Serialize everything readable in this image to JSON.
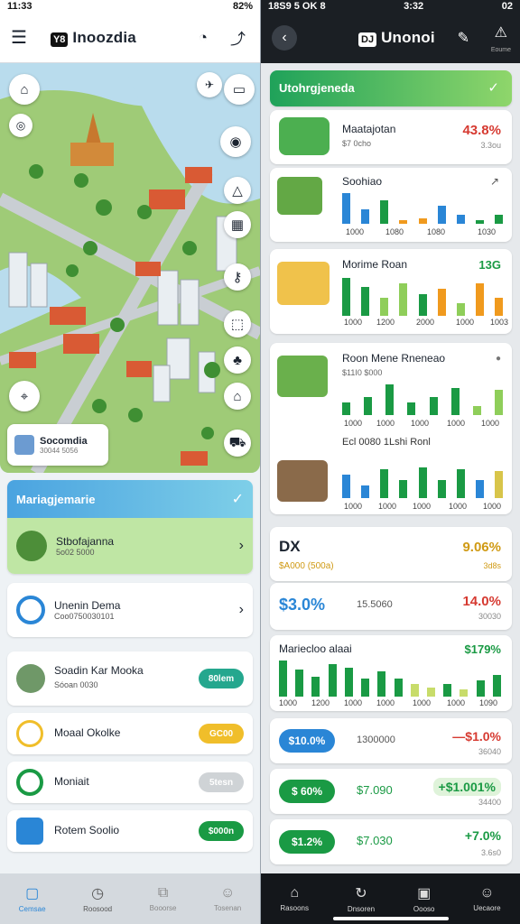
{
  "left": {
    "status": {
      "time": "11:33",
      "battery": "82%"
    },
    "title": "Inoozdia",
    "logo": "Y8",
    "map_label": {
      "title": "Socomdia",
      "sub": "30044 5056"
    },
    "section": {
      "title": "Mariagjemarie"
    },
    "rows": [
      {
        "title": "Stbofajanna",
        "sub": "5o02 5000",
        "action": "›"
      },
      {
        "title": "Unenin Dema",
        "sub": "Coo0750030101",
        "action": "›"
      },
      {
        "title": "Soadin Kar Mooka",
        "sub": "Sóoan 0030",
        "pill": "80lem",
        "color": "#25a78e"
      },
      {
        "title": "Moaal Okolke",
        "sub": "",
        "pill": "GC00",
        "color": "#f0be2a"
      },
      {
        "title": "Moniait",
        "sub": "",
        "pill": "5tesn",
        "color": "#cfd3d6"
      },
      {
        "title": "Rotem Soolio",
        "sub": "",
        "pill": "$000n",
        "color": "#1a9a44"
      }
    ],
    "tabs": [
      "Cemsae",
      "Roosood",
      "Booorse",
      "Tosenan"
    ]
  },
  "right": {
    "status": {
      "time": "3:32",
      "carrier": "18S9 5 OK 8",
      "battery": "02"
    },
    "title": "Unonoi",
    "logo": "DJ",
    "header_note": "Eoume",
    "section": {
      "title": "Utohrgjeneda"
    },
    "row1": {
      "title": "Maatajotan",
      "sub": "$7 0cho",
      "value": "43.8%",
      "value_sub": "3.3ou"
    },
    "row2": {
      "title": "Soohiao",
      "labels": [
        "1000",
        "1080",
        "1080",
        "1030"
      ]
    },
    "row3": {
      "title": "Morime Roan",
      "value": "13G",
      "labels": [
        "1000",
        "1200",
        "2000",
        "1000",
        "1003"
      ]
    },
    "row4": {
      "title": "Roon Mene Rneneao",
      "sub": "$11I0 $000",
      "labels": [
        "1000",
        "1000",
        "1000",
        "1000",
        "1000"
      ],
      "legend": "Ecl  0080  1Lshi  Ronl"
    },
    "stat": {
      "big": "DX",
      "sub": "$A000  (500a)",
      "value": "9.06%",
      "value_sub": "3d8s"
    },
    "stat2": {
      "pct": "$3.0%",
      "mid": "15.5060",
      "value": "14.0%",
      "value_sub": "30030"
    },
    "chart": {
      "title": "Mariecloo alaai",
      "value": "$179%",
      "labels": [
        "1000",
        "1200",
        "1000",
        "1000",
        "1000",
        "1000",
        "1090"
      ]
    },
    "pills": [
      {
        "pill": "$10.0%",
        "mid": "1300000",
        "value": "—$1.0%",
        "value_sub": "36040",
        "color": "#2a86d6",
        "neg": true
      },
      {
        "pill": "$ 60%",
        "mid": "$7.090",
        "value": "+$1.001%",
        "value_sub": "34400",
        "color": "#1a9a44",
        "neg": false
      },
      {
        "pill": "$1.2%",
        "mid": "$7.030",
        "value": "+7.0%",
        "value_sub": "3.6s0",
        "color": "#1a9a44",
        "neg": false
      }
    ],
    "tabs": [
      "Rasoons",
      "Dnsoren",
      "Oooso",
      "Uecaore"
    ]
  },
  "colors": {
    "green": "#1a9a44",
    "light_green": "#8fce5a",
    "blue": "#2a86d6",
    "orange": "#f09a1e",
    "red": "#d63a31"
  }
}
